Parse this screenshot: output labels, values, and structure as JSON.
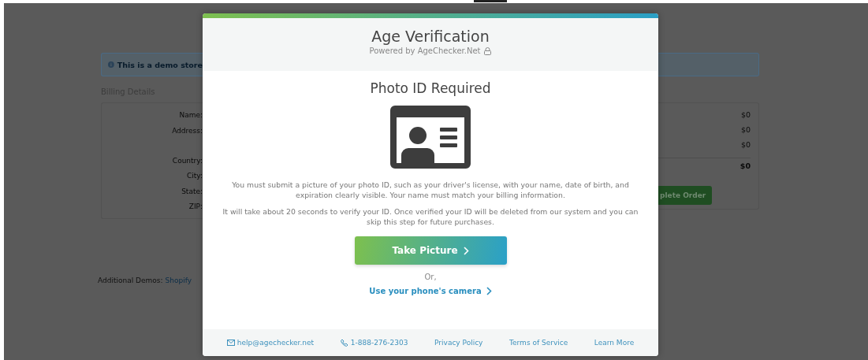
{
  "backdrop": {
    "notice": "This is a demo store",
    "billing_heading": "Billing Details",
    "billing_labels": [
      "Name:",
      "Address:",
      "Country:",
      "City:",
      "State:",
      "ZIP:"
    ],
    "totals": [
      "$0",
      "$0",
      "$0"
    ],
    "grand_total": "$0",
    "order_button": "plete Order",
    "demos_label": "Additional Demos:",
    "demos_link": "Shopify"
  },
  "modal": {
    "title": "Age Verification",
    "subtitle": "Powered by AgeChecker.Net",
    "heading": "Photo ID Required",
    "paragraphs": [
      "You must submit a picture of your photo ID, such as your driver's license, with your name, date of birth, and expiration clearly visible. Your name must match your billing information.",
      "It will take about 20 seconds to verify your ID. Once verified your ID will be deleted from our system and you can skip this step for future purchases."
    ],
    "primary_button": "Take Picture",
    "or_text": "Or,",
    "alt_link": "Use your phone's camera",
    "footer_links": [
      {
        "kind": "email",
        "label": "help@agechecker.net"
      },
      {
        "kind": "phone",
        "label": "1-888-276-2303"
      },
      {
        "kind": "plain",
        "label": "Privacy Policy"
      },
      {
        "kind": "plain",
        "label": "Terms of Service"
      },
      {
        "kind": "plain",
        "label": "Learn More"
      }
    ]
  }
}
